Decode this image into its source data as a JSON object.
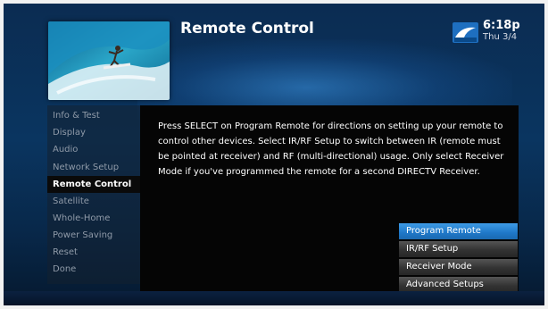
{
  "header": {
    "title": "Remote Control",
    "time": "6:18p",
    "date": "Thu 3/4",
    "logo_icon": "directv-logo-icon"
  },
  "sidebar": {
    "items": [
      {
        "label": "Info & Test"
      },
      {
        "label": "Display"
      },
      {
        "label": "Audio"
      },
      {
        "label": "Network Setup"
      },
      {
        "label": "Remote Control",
        "active": true
      },
      {
        "label": "Satellite"
      },
      {
        "label": "Whole-Home"
      },
      {
        "label": "Power Saving"
      },
      {
        "label": "Reset"
      },
      {
        "label": "Done"
      }
    ]
  },
  "main": {
    "description": "Press SELECT on Program Remote for directions on setting up your remote to control other devices. Select IR/RF Setup to switch between IR (remote must be pointed at receiver) and RF (multi-directional) usage. Only select Receiver Mode if you've programmed the remote for a second DIRECTV Receiver.",
    "options": [
      {
        "label": "Program Remote",
        "selected": true
      },
      {
        "label": "IR/RF Setup"
      },
      {
        "label": "Receiver Mode"
      },
      {
        "label": "Advanced Setups"
      }
    ]
  },
  "colors": {
    "background": "#0a3560",
    "selected": "#2a88d8",
    "panel": "#050505"
  }
}
